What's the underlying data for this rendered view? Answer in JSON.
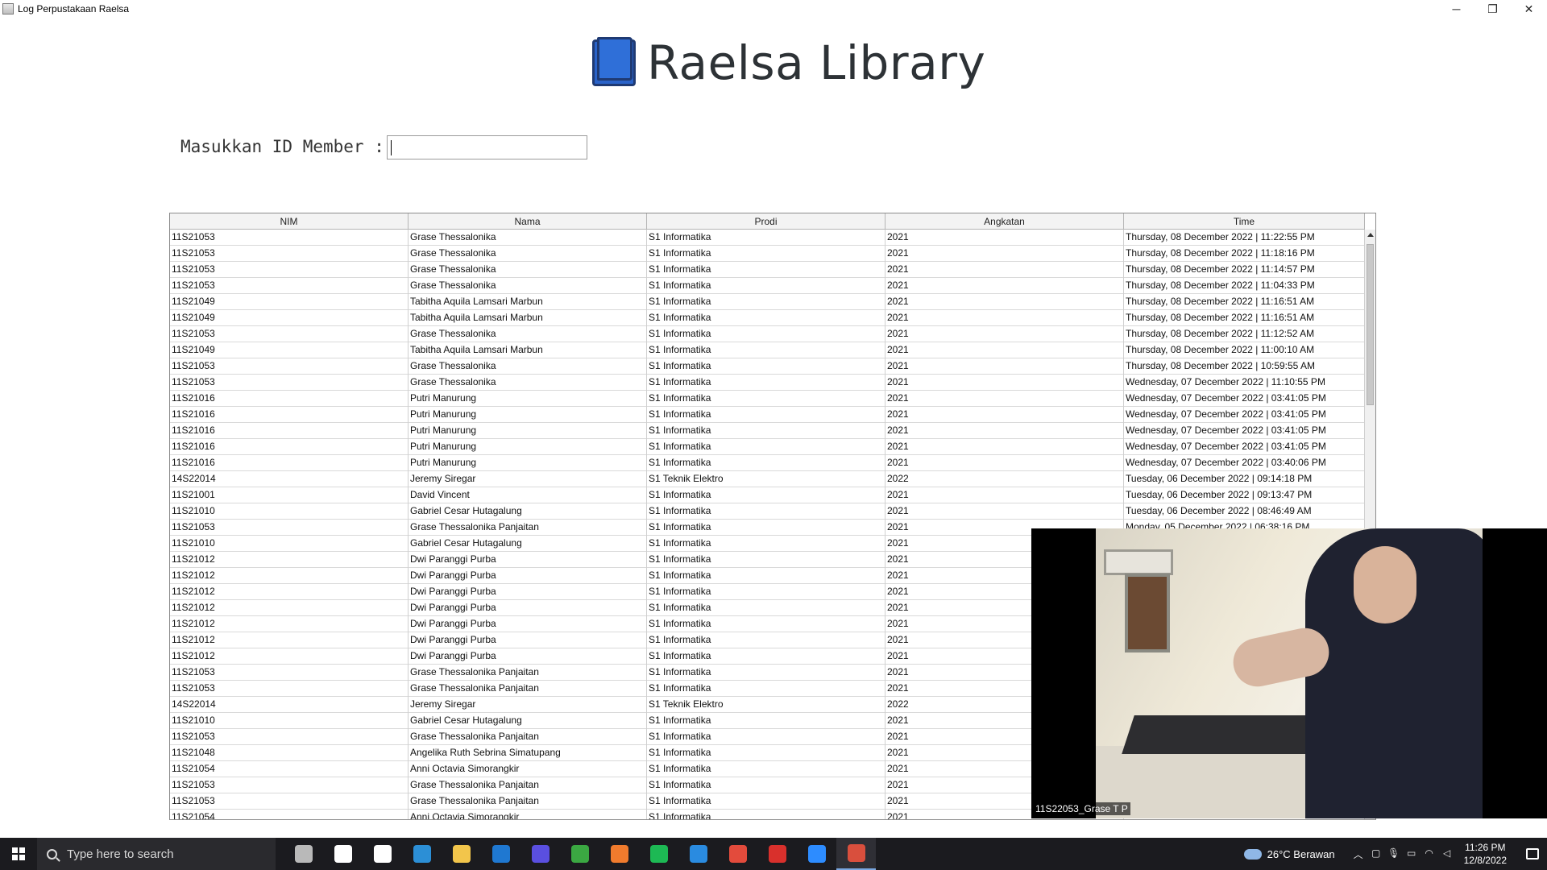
{
  "window": {
    "title": "Log Perpustakaan Raelsa",
    "controls": {
      "minimize": "─",
      "restore": "❐",
      "close": "✕"
    }
  },
  "header": {
    "brand": "Raelsa Library",
    "logo_icon": "book-icon",
    "logo_color": "#2a63c9"
  },
  "member": {
    "label": "Masukkan ID Member :",
    "value": ""
  },
  "table": {
    "columns": [
      "NIM",
      "Nama",
      "Prodi",
      "Angkatan",
      "Time"
    ],
    "rows": [
      [
        "11S21053",
        "Grase Thessalonika",
        "S1 Informatika",
        "2021",
        "Thursday, 08 December 2022 | 11:22:55 PM"
      ],
      [
        "11S21053",
        "Grase Thessalonika",
        "S1 Informatika",
        "2021",
        "Thursday, 08 December 2022 | 11:18:16 PM"
      ],
      [
        "11S21053",
        "Grase Thessalonika",
        "S1 Informatika",
        "2021",
        "Thursday, 08 December 2022 | 11:14:57 PM"
      ],
      [
        "11S21053",
        "Grase Thessalonika",
        "S1 Informatika",
        "2021",
        "Thursday, 08 December 2022 | 11:04:33 PM"
      ],
      [
        "11S21049",
        "Tabitha Aquila Lamsari Marbun",
        "S1 Informatika",
        "2021",
        "Thursday, 08 December 2022 | 11:16:51 AM"
      ],
      [
        "11S21049",
        "Tabitha Aquila Lamsari Marbun",
        "S1 Informatika",
        "2021",
        "Thursday, 08 December 2022 | 11:16:51 AM"
      ],
      [
        "11S21053",
        "Grase Thessalonika",
        "S1 Informatika",
        "2021",
        "Thursday, 08 December 2022 | 11:12:52 AM"
      ],
      [
        "11S21049",
        "Tabitha Aquila Lamsari Marbun",
        "S1 Informatika",
        "2021",
        "Thursday, 08 December 2022 | 11:00:10 AM"
      ],
      [
        "11S21053",
        "Grase Thessalonika",
        "S1 Informatika",
        "2021",
        "Thursday, 08 December 2022 | 10:59:55 AM"
      ],
      [
        "11S21053",
        "Grase Thessalonika",
        "S1 Informatika",
        "2021",
        "Wednesday, 07 December 2022 | 11:10:55 PM"
      ],
      [
        "11S21016",
        "Putri Manurung",
        "S1 Informatika",
        "2021",
        "Wednesday, 07 December 2022 | 03:41:05 PM"
      ],
      [
        "11S21016",
        "Putri Manurung",
        "S1 Informatika",
        "2021",
        "Wednesday, 07 December 2022 | 03:41:05 PM"
      ],
      [
        "11S21016",
        "Putri Manurung",
        "S1 Informatika",
        "2021",
        "Wednesday, 07 December 2022 | 03:41:05 PM"
      ],
      [
        "11S21016",
        "Putri Manurung",
        "S1 Informatika",
        "2021",
        "Wednesday, 07 December 2022 | 03:41:05 PM"
      ],
      [
        "11S21016",
        "Putri Manurung",
        "S1 Informatika",
        "2021",
        "Wednesday, 07 December 2022 | 03:40:06 PM"
      ],
      [
        "14S22014",
        "Jeremy Siregar",
        "S1 Teknik Elektro",
        "2022",
        "Tuesday, 06 December 2022 | 09:14:18 PM"
      ],
      [
        "11S21001",
        "David Vincent",
        "S1 Informatika",
        "2021",
        "Tuesday, 06 December 2022 | 09:13:47 PM"
      ],
      [
        "11S21010",
        "Gabriel Cesar Hutagalung",
        "S1 Informatika",
        "2021",
        "Tuesday, 06 December 2022 | 08:46:49 AM"
      ],
      [
        "11S21053",
        "Grase Thessalonika Panjaitan",
        "S1 Informatika",
        "2021",
        "Monday, 05 December 2022 | 06:38:16 PM"
      ],
      [
        "11S21010",
        "Gabriel Cesar Hutagalung",
        "S1 Informatika",
        "2021",
        ""
      ],
      [
        "11S21012",
        "Dwi Paranggi Purba",
        "S1 Informatika",
        "2021",
        ""
      ],
      [
        "11S21012",
        "Dwi Paranggi Purba",
        "S1 Informatika",
        "2021",
        ""
      ],
      [
        "11S21012",
        "Dwi Paranggi Purba",
        "S1 Informatika",
        "2021",
        ""
      ],
      [
        "11S21012",
        "Dwi Paranggi Purba",
        "S1 Informatika",
        "2021",
        ""
      ],
      [
        "11S21012",
        "Dwi Paranggi Purba",
        "S1 Informatika",
        "2021",
        ""
      ],
      [
        "11S21012",
        "Dwi Paranggi Purba",
        "S1 Informatika",
        "2021",
        ""
      ],
      [
        "11S21012",
        "Dwi Paranggi Purba",
        "S1 Informatika",
        "2021",
        ""
      ],
      [
        "11S21053",
        "Grase Thessalonika Panjaitan",
        "S1 Informatika",
        "2021",
        ""
      ],
      [
        "11S21053",
        "Grase Thessalonika Panjaitan",
        "S1 Informatika",
        "2021",
        ""
      ],
      [
        "14S22014",
        "Jeremy Siregar",
        "S1 Teknik Elektro",
        "2022",
        ""
      ],
      [
        "11S21010",
        "Gabriel Cesar Hutagalung",
        "S1 Informatika",
        "2021",
        ""
      ],
      [
        "11S21053",
        "Grase Thessalonika Panjaitan",
        "S1 Informatika",
        "2021",
        ""
      ],
      [
        "11S21048",
        "Angelika Ruth Sebrina Simatupang",
        "S1 Informatika",
        "2021",
        ""
      ],
      [
        "11S21054",
        "Anni Octavia Simorangkir",
        "S1 Informatika",
        "2021",
        ""
      ],
      [
        "11S21053",
        "Grase Thessalonika Panjaitan",
        "S1 Informatika",
        "2021",
        ""
      ],
      [
        "11S21053",
        "Grase Thessalonika Panjaitan",
        "S1 Informatika",
        "2021",
        ""
      ],
      [
        "11S21054",
        "Anni Octavia Simorangkir",
        "S1 Informatika",
        "2021",
        ""
      ]
    ]
  },
  "video": {
    "caption": "11S22053_Grase T P"
  },
  "taskbar": {
    "search_placeholder": "Type here to search",
    "apps": [
      {
        "icon": "tools-icon",
        "color": "#b9b9b9"
      },
      {
        "icon": "cortana-icon",
        "color": "#ffffff"
      },
      {
        "icon": "task-view-icon",
        "color": "#ffffff"
      },
      {
        "icon": "edge-icon",
        "color": "#2c8fd6"
      },
      {
        "icon": "file-explorer-icon",
        "color": "#f2c54b"
      },
      {
        "icon": "mail-icon",
        "color": "#1f78d1"
      },
      {
        "icon": "sketch-app-icon",
        "color": "#5a4fe0"
      },
      {
        "icon": "xbox-icon",
        "color": "#3ba842"
      },
      {
        "icon": "xampp-icon",
        "color": "#f07b2d"
      },
      {
        "icon": "spotify-icon",
        "color": "#1db954"
      },
      {
        "icon": "vscode-icon",
        "color": "#2a8be0"
      },
      {
        "icon": "chrome-icon",
        "color": "#e34b3c"
      },
      {
        "icon": "acrobat-icon",
        "color": "#d9302c"
      },
      {
        "icon": "zoom-icon",
        "color": "#2d8cff"
      },
      {
        "icon": "java-app-icon",
        "color": "#d94f3d"
      }
    ],
    "weather": "26°C  Berawan",
    "time": "11:26 PM",
    "date": "12/8/2022"
  }
}
